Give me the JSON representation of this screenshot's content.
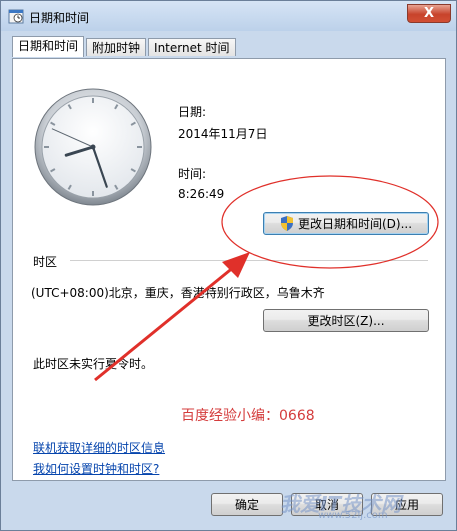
{
  "window": {
    "title": "日期和时间",
    "close_label": "X"
  },
  "tabs": [
    {
      "label": "日期和时间"
    },
    {
      "label": "附加时钟"
    },
    {
      "label": "Internet 时间"
    }
  ],
  "clock": {
    "hour": 8,
    "minute": 26,
    "second": 49
  },
  "date": {
    "label": "日期:",
    "value": "2014年11月7日"
  },
  "time": {
    "label": "时间:",
    "value": "8:26:49"
  },
  "buttons": {
    "change_datetime": "更改日期和时间(D)...",
    "change_timezone": "更改时区(Z)...",
    "ok": "确定",
    "cancel": "取消",
    "apply": "应用"
  },
  "timezone": {
    "section_label": "时区",
    "value": "(UTC+08:00)北京，重庆，香港特别行政区，乌鲁木齐",
    "dst_note": "此时区未实行夏令时。"
  },
  "watermark": {
    "text": "百度经验小编：0668",
    "logo": "我爱IT技术网",
    "url": "www.52ij.com"
  },
  "links": {
    "online_info": "联机获取详细的时区信息",
    "how_to_set": "我如何设置时钟和时区?"
  },
  "colors": {
    "annotation": "#e0302a",
    "link": "#0645ad"
  }
}
